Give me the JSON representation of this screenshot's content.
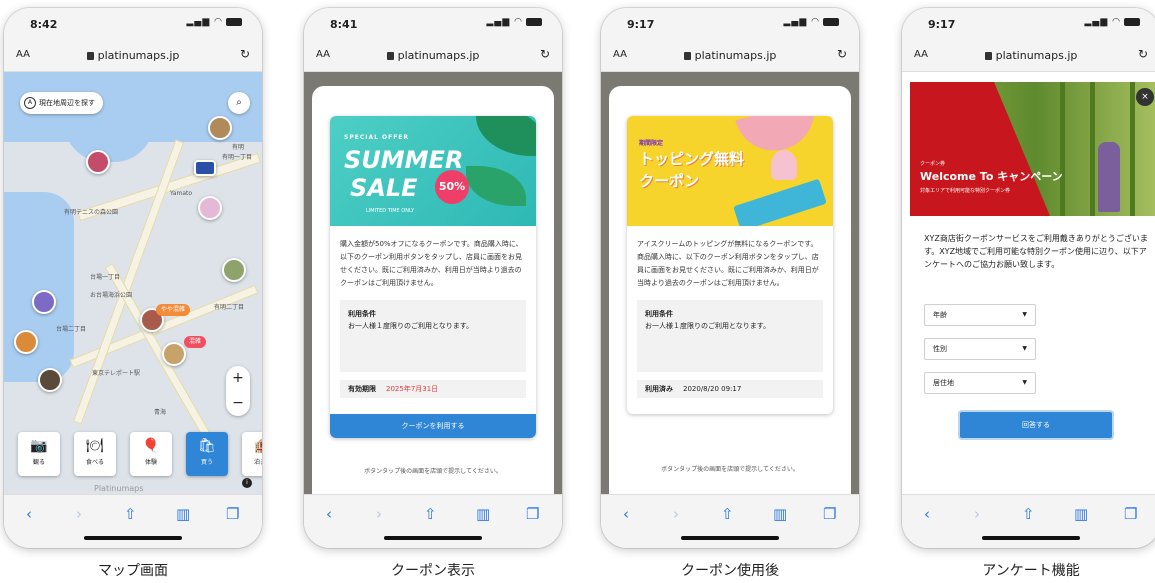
{
  "url": "platinumaps.jp",
  "aa_label": "AA",
  "phones": [
    {
      "time": "8:42",
      "caption": "マップ画面"
    },
    {
      "time": "8:41",
      "caption": "クーポン表示"
    },
    {
      "time": "9:17",
      "caption": "クーポン使用後"
    },
    {
      "time": "9:17",
      "caption": "アンケート機能"
    }
  ],
  "map": {
    "search_nearby": "現在地周辺を探す",
    "tags": [
      "やや混雑",
      "混雑"
    ],
    "labels": [
      "有明",
      "有明一丁目",
      "有明テニスの森公園",
      "台場一丁目",
      "お台場海浜公園",
      "台場二丁目",
      "東京テレポート駅",
      "青海",
      "有明二丁目",
      "Yamato"
    ],
    "categories": [
      "観る",
      "食べる",
      "体験",
      "買う",
      "泊まる"
    ],
    "brand": "Platinumaps",
    "colors": {
      "accent": "#2f86d6",
      "tag_orange": "#f28b3a",
      "tag_red": "#ef4f5f"
    }
  },
  "coupon": {
    "banner": {
      "special": "SPECIAL OFFER",
      "title1": "SUMMER",
      "title2": "SALE",
      "off": "50%",
      "limited": "LIMITED TIME ONLY"
    },
    "desc": "購入金額が50%オフになるクーポンです。商品購入時に、以下のクーポン利用ボタンをタップし、店員に画面をお見せください。既にご利用済みか、利用日が当時より過去のクーポンはご利用頂けません。",
    "cond_title": "利用条件",
    "cond_body": "お一人様１度限りのご利用となります。",
    "expiry_label": "有効期限",
    "expiry_value": "2025年7月31日",
    "use_button": "クーポンを利用する",
    "note": "ボタンタップ後の画面を店頭で提示してください。"
  },
  "used": {
    "banner": {
      "limited": "期間限定",
      "title1": "トッピング無料",
      "title2": "クーポン"
    },
    "desc": "アイスクリームのトッピングが無料になるクーポンです。商品購入時に、以下のクーポン利用ボタンをタップし、店員に画面をお見せください。既にご利用済みか、利用日が当時より過去のクーポンはご利用頂けません。",
    "cond_title": "利用条件",
    "cond_body": "お一人様１度限りのご利用となります。",
    "used_label": "利用済み",
    "used_value": "2020/8/20 09:17",
    "note": "ボタンタップ後の画面を店頭で提示してください。"
  },
  "survey": {
    "banner_small": "クーポン券",
    "banner_title": "Welcome To キャンペーン",
    "banner_sub": "対象エリアで利用可能な特別クーポン券",
    "intro": "XYZ商店街クーポンサービスをご利用戴きありがとうございます。XYZ地域でご利用可能な特別クーポン使用に辺り、以下アンケートへのご協力お願い致します。",
    "fields": [
      "年齢",
      "性別",
      "居住地"
    ],
    "answer_button": "回答する"
  }
}
